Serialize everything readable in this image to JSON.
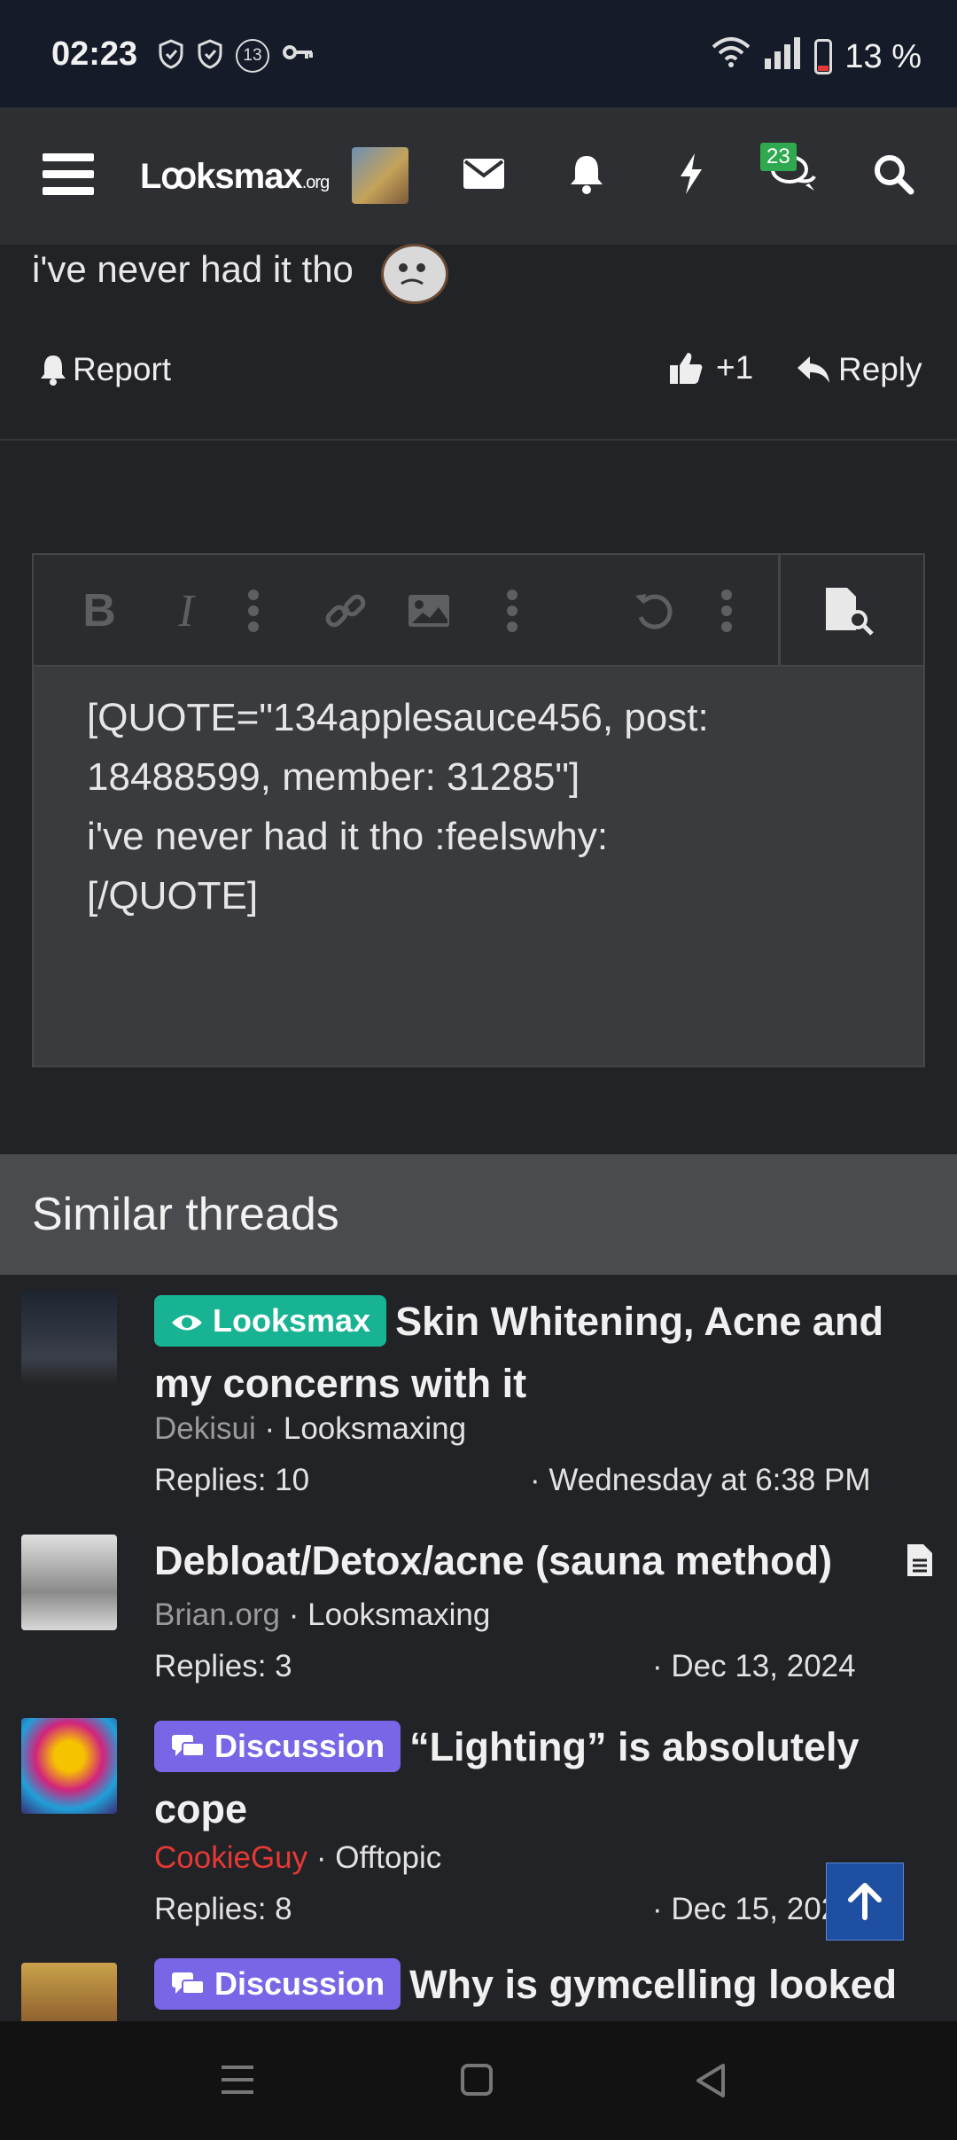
{
  "status_bar": {
    "time": "02:23",
    "notif_count": "13",
    "battery": "13 %"
  },
  "header": {
    "logo_text": "Lꝏksmax",
    "logo_suffix": ".org",
    "chat_badge": "23"
  },
  "post": {
    "text": "i've never had it tho",
    "report_label": "Report",
    "like_count": "+1",
    "reply_label": "Reply"
  },
  "editor": {
    "content": "[QUOTE=\"134applesauce456, post: 18488599, member: 31285\"]\ni've never had it tho :feelswhy:\n[/QUOTE]"
  },
  "similar": {
    "heading": "Similar threads",
    "threads": [
      {
        "prefix": "Looksmax",
        "title": "Skin Whitening, Acne and my concerns with it",
        "author": "Dekisui",
        "forum": "Looksmaxing",
        "replies": "Replies: 10",
        "date": "· Wednesday at 6:38 PM"
      },
      {
        "prefix": "",
        "title": "Debloat/Detox/acne (sauna method)",
        "author": "Brian.org",
        "forum": "Looksmaxing",
        "replies": "Replies: 3",
        "date": "· Dec 13, 2024"
      },
      {
        "prefix": "Discussion",
        "title": "“Lighting” is absolutely cope",
        "author": "CookieGuy",
        "forum": "Offtopic",
        "replies": "Replies: 8",
        "date": "· Dec 15, 2024"
      },
      {
        "prefix": "Discussion",
        "title": "Why is gymcelling looked",
        "author": "",
        "forum": "",
        "replies": "",
        "date": ""
      }
    ]
  },
  "colors": {
    "looksmax_prefix": "#18b393",
    "discussion_prefix": "#7766e6",
    "header_bg": "#2e2f33",
    "badge": "#2fa84f"
  }
}
